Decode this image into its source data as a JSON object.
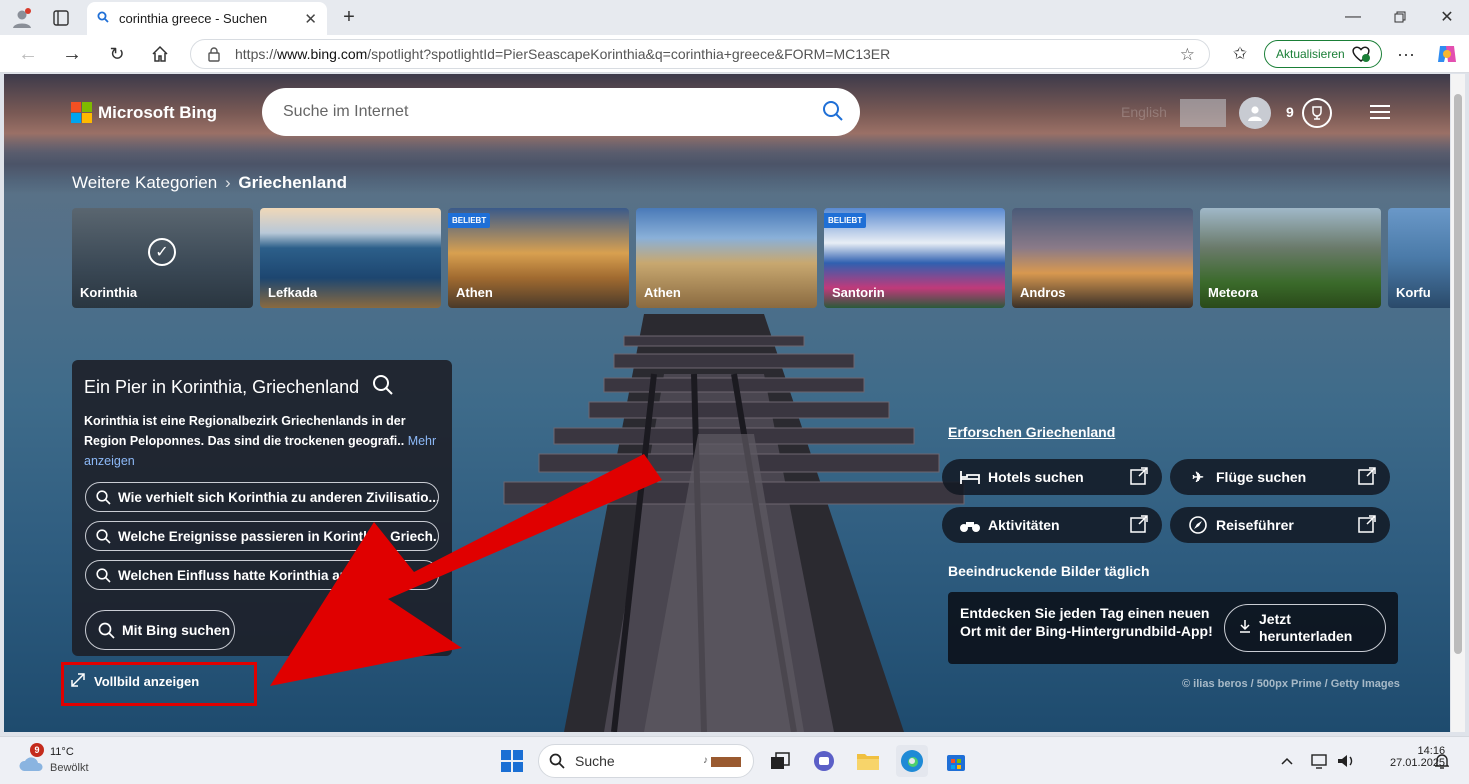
{
  "browser": {
    "tab_title": "corinthia greece - Suchen",
    "url_prefix": "https://",
    "url_host": "www.bing.com",
    "url_rest": "/spotlight?spotlightId=PierSeascapeKorinthia&q=corinthia+greece&FORM=MC13ER",
    "update_label": "Aktualisieren"
  },
  "header": {
    "brand": "Microsoft Bing",
    "search_placeholder": "Suche im Internet",
    "language": "English",
    "rewards_count": "9"
  },
  "breadcrumb": {
    "parent": "Weitere Kategorien",
    "current": "Griechenland"
  },
  "categories": [
    {
      "label": "Korinthia",
      "badge": "",
      "selected": true
    },
    {
      "label": "Lefkada",
      "badge": ""
    },
    {
      "label": "Athen",
      "badge": "BELIEBT"
    },
    {
      "label": "Athen",
      "badge": ""
    },
    {
      "label": "Santorin",
      "badge": "BELIEBT"
    },
    {
      "label": "Andros",
      "badge": ""
    },
    {
      "label": "Meteora",
      "badge": ""
    },
    {
      "label": "Korfu",
      "badge": ""
    }
  ],
  "info": {
    "title": "Ein Pier in Korinthia, Griechenland",
    "description": "Korinthia ist eine Regionalbezirk Griechenlands in der Region Peloponnes. Das sind die trockenen geografi..",
    "more_label": "Mehr anzeigen",
    "questions": [
      "Wie verhielt sich Korinthia zu anderen Zivilisatio...",
      "Welche Ereignisse passieren in Korinthia, Griech...",
      "Welchen Einfluss hatte Korinthia auf Griechi..."
    ],
    "bing_search": "Mit Bing suchen"
  },
  "fullscreen_label": "Vollbild anzeigen",
  "explore": {
    "title": "Erforschen Griechenland",
    "actions": [
      "Hotels suchen",
      "Flüge suchen",
      "Aktivitäten",
      "Reiseführer"
    ]
  },
  "daily": {
    "title": "Beeindruckende Bilder täglich",
    "promo_text": "Entdecken Sie jeden Tag einen neuen Ort mit der Bing-Hintergrundbild-App!",
    "download": "Jetzt herunterladen"
  },
  "credit": "© ilias beros / 500px Prime / Getty Images",
  "taskbar": {
    "weather_temp": "11°C",
    "weather_desc": "Bewölkt",
    "weather_badge": "9",
    "search": "Suche",
    "time": "14:16",
    "date": "27.01.2025"
  },
  "colors": {
    "arrow": "#e00000",
    "accent": "#1f6fd6",
    "update_green": "#1a7f37"
  }
}
